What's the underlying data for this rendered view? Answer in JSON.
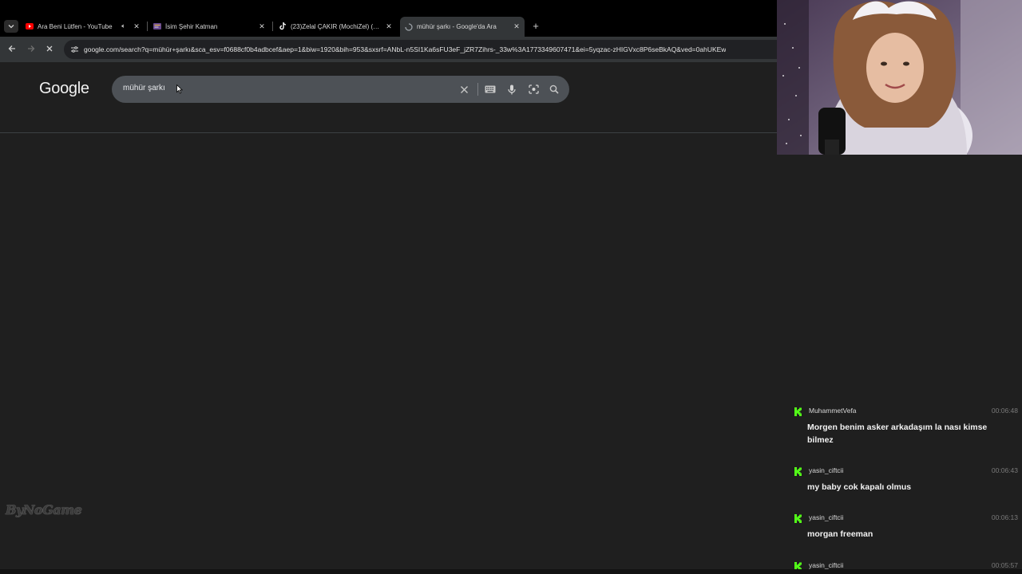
{
  "browser": {
    "tabs": [
      {
        "title": "Ara Beni Lütfen - YouTube",
        "favicon": "youtube-icon",
        "audio": true,
        "active": false
      },
      {
        "title": "İsim Şehir Katman",
        "favicon": "page-icon",
        "audio": false,
        "active": false
      },
      {
        "title": "(23)Zelal ÇAKIR (MochiZel) (@…",
        "favicon": "tiktok-icon",
        "audio": false,
        "active": false
      },
      {
        "title": "mühür şarkı - Google'da Ara",
        "favicon": "loading-spinner-icon",
        "audio": false,
        "active": true
      }
    ],
    "new_tab_label": "+",
    "url": "google.com/search?q=mühür+şarkı&sca_esv=f0688cf0b4adbcef&aep=1&biw=1920&bih=953&sxsrf=ANbL-n5SI1Ka6sFU3eF_jZR7Zihrs-_33w%3A1773349607471&ei=5yqzac-zHIGVxc8P6seBkAQ&ved=0ahUKEw"
  },
  "google": {
    "logo_text": "Google",
    "query": "mühür şarkı"
  },
  "overlay": {
    "watermark_text": "ByNoGame"
  },
  "chat": {
    "messages": [
      {
        "user": "MuhammetVefa",
        "time": "00:06:48",
        "text": "Morgen benim asker arkadaşım la nası kimse bilmez"
      },
      {
        "user": "yasin_ciftcii",
        "time": "00:06:43",
        "text": "my baby cok kapalı olmus"
      },
      {
        "user": "yasin_ciftcii",
        "time": "00:06:13",
        "text": "morgan freeman"
      },
      {
        "user": "yasin_ciftcii",
        "time": "00:05:57",
        "text": ""
      }
    ]
  },
  "colors": {
    "kick_green": "#53fc18",
    "youtube_red": "#ff0000",
    "page_bg": "#1f1f1f",
    "tabstrip_bg": "#000000",
    "toolbar_bg": "#333638",
    "searchbox_bg": "#4d5156"
  }
}
